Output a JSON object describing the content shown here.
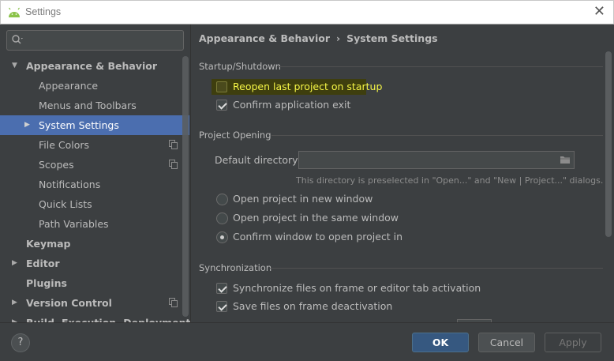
{
  "window": {
    "title": "Settings",
    "close_glyph": "✕"
  },
  "search": {
    "value": "",
    "icon": "search-icon"
  },
  "sidebar": {
    "items": [
      {
        "label": "Appearance & Behavior",
        "arrow": "▼",
        "bold": true
      },
      {
        "label": "Appearance"
      },
      {
        "label": "Menus and Toolbars"
      },
      {
        "label": "System Settings",
        "arrow": "▶",
        "selected": true
      },
      {
        "label": "File Colors",
        "copy_icon": true
      },
      {
        "label": "Scopes",
        "copy_icon": true
      },
      {
        "label": "Notifications"
      },
      {
        "label": "Quick Lists"
      },
      {
        "label": "Path Variables"
      },
      {
        "label": "Keymap",
        "bold": true
      },
      {
        "label": "Editor",
        "arrow": "▶",
        "bold": true
      },
      {
        "label": "Plugins",
        "bold": true
      },
      {
        "label": "Version Control",
        "arrow": "▶",
        "bold": true,
        "copy_icon": true
      },
      {
        "label": "Build, Execution, Deployment",
        "arrow": "▶",
        "bold": true
      }
    ]
  },
  "breadcrumb": {
    "parent": "Appearance & Behavior",
    "separator": "›",
    "current": "System Settings"
  },
  "startup": {
    "title": "Startup/Shutdown",
    "reopen_label": "Reopen last project on startup",
    "reopen_checked": false,
    "confirm_exit_label": "Confirm application exit",
    "confirm_exit_checked": true
  },
  "project_opening": {
    "title": "Project Opening",
    "default_dir_label": "Default directory:",
    "default_dir_value": "",
    "hint": "This directory is preselected in \"Open...\" and \"New | Project...\" dialogs.",
    "options": [
      {
        "label": "Open project in new window",
        "checked": false
      },
      {
        "label": "Open project in the same window",
        "checked": false
      },
      {
        "label": "Confirm window to open project in",
        "checked": true
      }
    ]
  },
  "sync": {
    "title": "Synchronization",
    "sync_label": "Synchronize files on frame or editor tab activation",
    "sync_checked": true,
    "save_label": "Save files on frame deactivation",
    "save_checked": true
  },
  "footer": {
    "help": "?",
    "ok": "OK",
    "cancel": "Cancel",
    "apply": "Apply"
  },
  "colors": {
    "selection": "#4b6eaf",
    "highlight_text": "#f5f546",
    "ok_button": "#365880"
  }
}
